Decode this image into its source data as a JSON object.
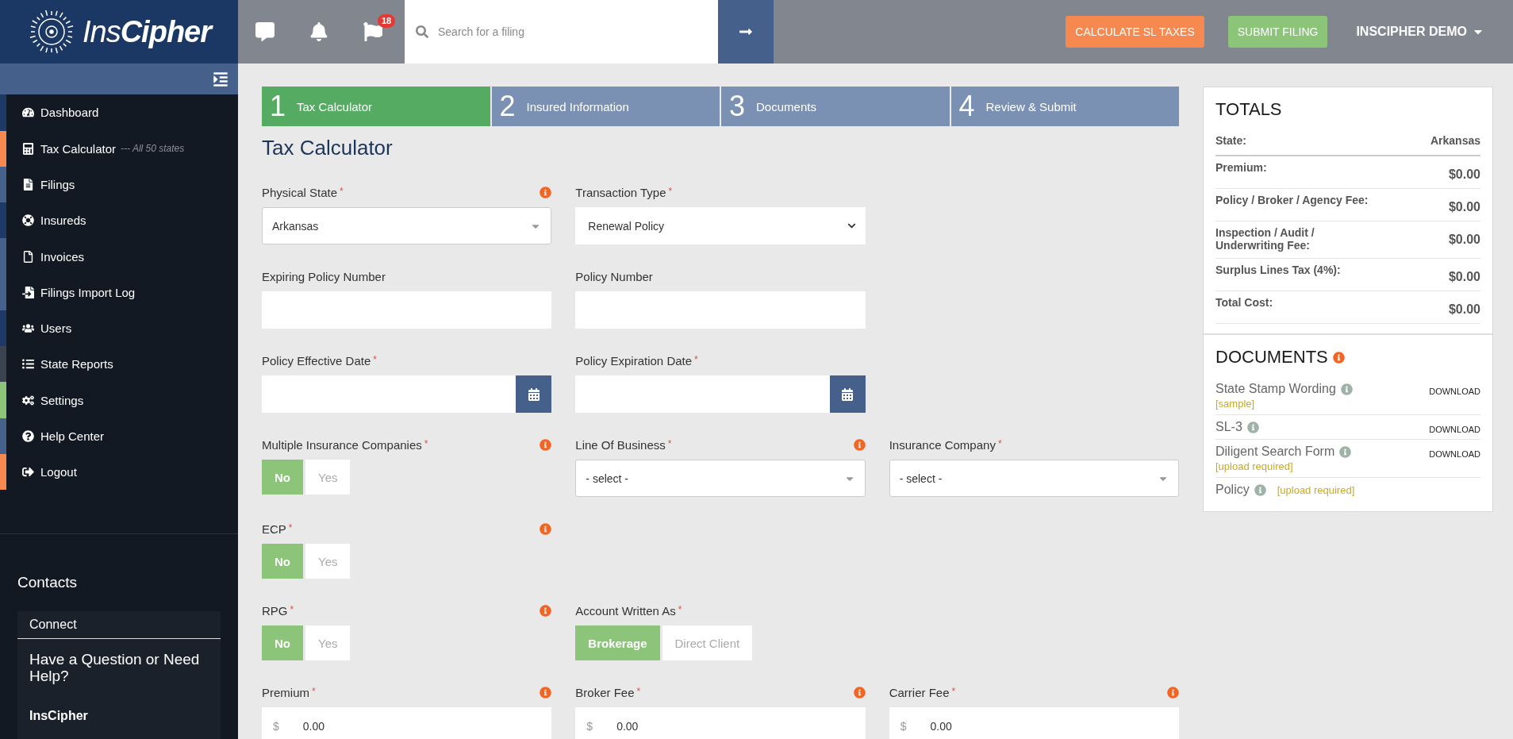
{
  "topbar": {
    "logo": "Ins**Cipher**",
    "flag_badge": "18",
    "search": {
      "placeholder": "Search for a filing"
    },
    "buttons": [
      {
        "label": "CALCULATE SL TAXES",
        "kind": "orange"
      },
      {
        "label": "SUBMIT FILING",
        "kind": "green"
      }
    ],
    "user_menu": "INSCIPHER DEMO"
  },
  "sidebar": {
    "items": [
      {
        "label": "Dashboard",
        "color": "#1d3a66"
      },
      {
        "label": "Tax Calculator",
        "note": "--- All 50 states",
        "color": "#f5894f"
      },
      {
        "label": "Filings",
        "color": "#46618c"
      },
      {
        "label": "Insureds",
        "color": "#1d3a66"
      },
      {
        "label": "Invoices",
        "color": "#46618c"
      },
      {
        "label": "Filings Import Log",
        "color": "#46618c"
      },
      {
        "label": "Users",
        "color": "#1d3a66"
      },
      {
        "label": "State Reports",
        "color": "#3b4250"
      },
      {
        "label": "Settings",
        "color": "#8cc57a"
      },
      {
        "label": "Help Center",
        "color": "#46618c"
      },
      {
        "label": "Logout",
        "color": "#f5894f"
      }
    ],
    "contacts": {
      "title": "Contacts",
      "tab": "Connect",
      "heading": "Have a Question or Need Help?",
      "name": "InsCipher"
    }
  },
  "steps": [
    {
      "number": "1",
      "label": "Tax Calculator",
      "selected": true
    },
    {
      "number": "2",
      "label": "Insured Information",
      "selected": false
    },
    {
      "number": "3",
      "label": "Documents",
      "selected": false
    },
    {
      "number": "4",
      "label": "Review & Submit",
      "selected": false
    }
  ],
  "title": "Tax Calculator",
  "rows": [
    {
      "fields": [
        {
          "label": "Physical State",
          "required_mark": "*",
          "info": true,
          "kind": "select",
          "value": "Arkansas"
        },
        {
          "label": "Transaction Type",
          "required_mark": "*",
          "info": false,
          "kind": "native-select",
          "value": "Renewal Policy"
        }
      ]
    },
    {
      "fields": [
        {
          "label": "Expiring Policy Number",
          "info": false,
          "kind": "text"
        },
        {
          "label": "Policy Number",
          "info": false,
          "kind": "text"
        }
      ]
    },
    {
      "fields": [
        {
          "label": "Policy Effective Date",
          "required_mark": "*",
          "info": false,
          "kind": "date"
        },
        {
          "label": "Policy Expiration Date",
          "required_mark": "*",
          "info": false,
          "kind": "date"
        }
      ]
    },
    {
      "fields": [
        {
          "label": "Multiple Insurance Companies",
          "required_mark": "*",
          "info": true,
          "kind": "toggle",
          "options": [
            {
              "label": "No",
              "selected": true
            },
            {
              "label": "Yes",
              "selected": false
            }
          ]
        },
        {
          "label": "Line Of Business",
          "required_mark": "*",
          "info": true,
          "kind": "select",
          "value": "- select -"
        },
        {
          "label": "Insurance Company",
          "required_mark": "*",
          "info": false,
          "kind": "select",
          "value": "- select -"
        }
      ]
    },
    {
      "fields": [
        {
          "label": "ECP",
          "required_mark": "*",
          "info": true,
          "kind": "toggle",
          "options": [
            {
              "label": "No",
              "selected": true
            },
            {
              "label": "Yes",
              "selected": false
            }
          ]
        }
      ]
    },
    {
      "fields": [
        {
          "label": "RPG",
          "required_mark": "*",
          "info": true,
          "kind": "toggle",
          "options": [
            {
              "label": "No",
              "selected": true
            },
            {
              "label": "Yes",
              "selected": false
            }
          ]
        },
        {
          "label": "Account Written As",
          "required_mark": "*",
          "info": false,
          "kind": "toggle",
          "options": [
            {
              "label": "Brokerage",
              "selected": true
            },
            {
              "label": "Direct Client",
              "selected": false
            }
          ]
        }
      ]
    },
    {
      "fields": [
        {
          "label": "Premium",
          "required_mark": "*",
          "info": true,
          "kind": "money",
          "prefix": "$",
          "value": "0.00"
        },
        {
          "label": "Broker Fee",
          "required_mark": "*",
          "info": true,
          "kind": "money",
          "prefix": "$",
          "value": "0.00"
        },
        {
          "label": "Carrier Fee",
          "required_mark": "*",
          "info": true,
          "kind": "money",
          "prefix": "$",
          "value": "0.00"
        }
      ]
    }
  ],
  "totals": {
    "title": "TOTALS",
    "state": {
      "label": "State:",
      "value": "Arkansas"
    },
    "rows": [
      {
        "label": "Premium:",
        "value": "$0.00"
      },
      {
        "label": "Policy / Broker / Agency Fee:",
        "value": "$0.00"
      },
      {
        "label": "Inspection / Audit / Underwriting Fee:",
        "value": "$0.00"
      },
      {
        "label": "Surplus Lines Tax (4%):",
        "value": "$0.00"
      },
      {
        "label": "Total Cost:",
        "value": "$0.00"
      }
    ]
  },
  "documents": {
    "title": "DOCUMENTS",
    "items": [
      {
        "name": "State Stamp Wording",
        "note": "[sample]",
        "action": "DOWNLOAD"
      },
      {
        "name": "SL-3",
        "action": "DOWNLOAD"
      },
      {
        "name": "Diligent Search Form",
        "note": "[upload required]",
        "action": "DOWNLOAD"
      },
      {
        "name": "Policy",
        "note": "[upload required]"
      }
    ]
  }
}
